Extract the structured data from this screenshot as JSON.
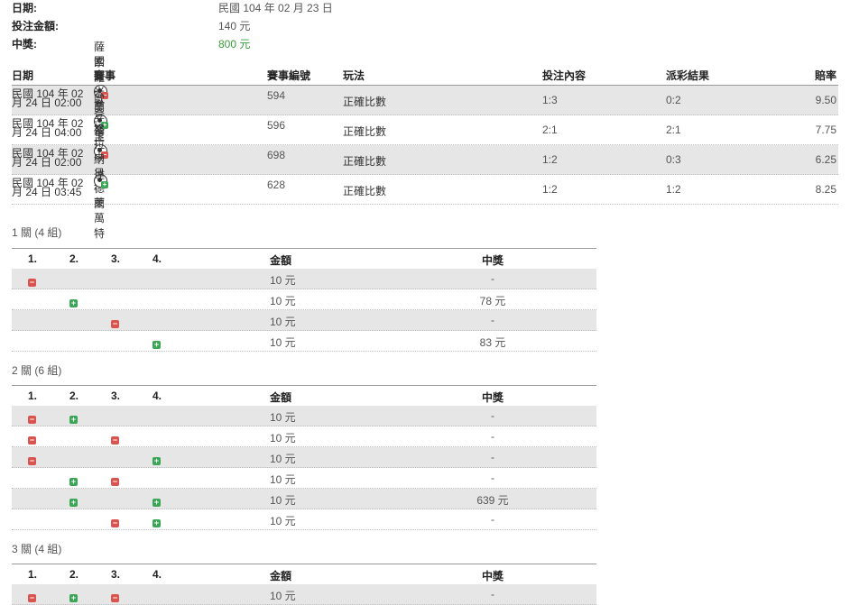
{
  "summary": {
    "date_label": "日期:",
    "date_value": "民國 104 年 02 月 23 日",
    "stake_label": "投注金額:",
    "stake_value": "140 元",
    "prize_label": "中獎:",
    "prize_value": "800 元"
  },
  "matches": {
    "headers": [
      "日期",
      "賽事",
      "賽事編號",
      "玩法",
      "投注內容",
      "派彩結果",
      "賠率"
    ],
    "rows": [
      {
        "date_line1": "民國 104 年 02",
        "date_line2": "月 24 日 02:00",
        "match": "薩索羅 - 拿坡里",
        "id": "594",
        "play": "正確比數",
        "bet": "1:3",
        "result": "0:2",
        "odds": "9.50",
        "outcome": "lose"
      },
      {
        "date_line1": "民國 104 年 02",
        "date_line2": "月 24 日 04:00",
        "match": "國際米蘭 - 卡利亞里",
        "id": "596",
        "play": "正確比數",
        "bet": "2:1",
        "result": "2:1",
        "odds": "7.75",
        "outcome": "win"
      },
      {
        "date_line1": "民國 104 年 02",
        "date_line2": "月 24 日 02:00",
        "match": "歐登塞 - 中日德蘭",
        "id": "698",
        "play": "正確比數",
        "bet": "1:2",
        "result": "0:3",
        "odds": "6.25",
        "outcome": "lose"
      },
      {
        "date_line1": "民國 104 年 02",
        "date_line2": "月 24 日 03:45",
        "match": "格拉納達 - 萊萬特",
        "id": "628",
        "play": "正確比數",
        "bet": "1:2",
        "result": "1:2",
        "odds": "8.25",
        "outcome": "win"
      }
    ]
  },
  "parlays": [
    {
      "title": "1 關 (4 組)",
      "headers": [
        "1.",
        "2.",
        "3.",
        "4.",
        "金額",
        "中獎"
      ],
      "rows": [
        {
          "marks": [
            "lose",
            "",
            "",
            ""
          ],
          "amount": "10 元",
          "win": "-"
        },
        {
          "marks": [
            "",
            "win",
            "",
            ""
          ],
          "amount": "10 元",
          "win": "78 元"
        },
        {
          "marks": [
            "",
            "",
            "lose",
            ""
          ],
          "amount": "10 元",
          "win": "-"
        },
        {
          "marks": [
            "",
            "",
            "",
            "win"
          ],
          "amount": "10 元",
          "win": "83 元"
        }
      ]
    },
    {
      "title": "2 關 (6 組)",
      "headers": [
        "1.",
        "2.",
        "3.",
        "4.",
        "金額",
        "中獎"
      ],
      "rows": [
        {
          "marks": [
            "lose",
            "win",
            "",
            ""
          ],
          "amount": "10 元",
          "win": "-"
        },
        {
          "marks": [
            "lose",
            "",
            "lose",
            ""
          ],
          "amount": "10 元",
          "win": "-"
        },
        {
          "marks": [
            "lose",
            "",
            "",
            "win"
          ],
          "amount": "10 元",
          "win": "-"
        },
        {
          "marks": [
            "",
            "win",
            "lose",
            ""
          ],
          "amount": "10 元",
          "win": "-"
        },
        {
          "marks": [
            "",
            "win",
            "",
            "win"
          ],
          "amount": "10 元",
          "win": "639 元"
        },
        {
          "marks": [
            "",
            "",
            "lose",
            "win"
          ],
          "amount": "10 元",
          "win": "-"
        }
      ]
    },
    {
      "title": "3 關 (4 組)",
      "headers": [
        "1.",
        "2.",
        "3.",
        "4.",
        "金額",
        "中獎"
      ],
      "rows": [
        {
          "marks": [
            "lose",
            "win",
            "lose",
            ""
          ],
          "amount": "10 元",
          "win": "-"
        }
      ]
    }
  ],
  "colors": {
    "win": "#3aa655",
    "lose": "#d9534f",
    "shade": "#e6e6e6",
    "prize": "#3a9a3a"
  },
  "icons": {
    "lose": "minus-icon",
    "win": "plus-icon",
    "match": "soccer-ball-icon"
  }
}
